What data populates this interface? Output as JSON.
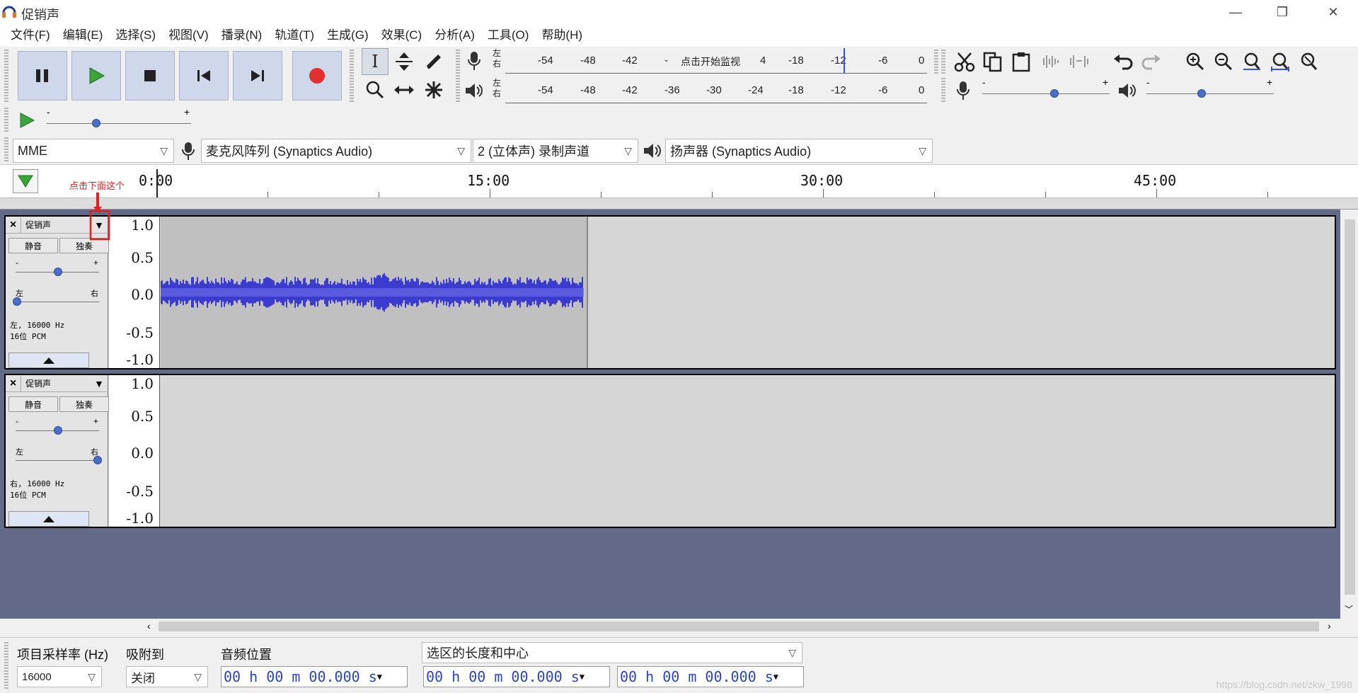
{
  "window": {
    "title": "促销声",
    "minimize_glyph": "—",
    "restore_glyph": "❐",
    "close_glyph": "✕"
  },
  "menu": [
    "文件(F)",
    "编辑(E)",
    "选择(S)",
    "视图(V)",
    "播录(N)",
    "轨道(T)",
    "生成(G)",
    "效果(C)",
    "分析(A)",
    "工具(O)",
    "帮助(H)"
  ],
  "meters": {
    "record_left": "左",
    "record_right": "右",
    "play_left": "左",
    "play_right": "右",
    "record_ticks": [
      "-54",
      "-48",
      "-42",
      "-",
      "点击开始监视",
      "4",
      "-18",
      "-12",
      "-6",
      "0"
    ],
    "play_ticks": [
      "-54",
      "-48",
      "-42",
      "-36",
      "-30",
      "-24",
      "-18",
      "-12",
      "-6",
      "0"
    ]
  },
  "mixer": {
    "minus": "-",
    "plus": "+"
  },
  "devices": {
    "host": "MME",
    "input": "麦克风阵列 (Synaptics Audio)",
    "channels": "2 (立体声) 录制声道",
    "output": "扬声器 (Synaptics Audio)"
  },
  "timeline": {
    "labels": [
      "0:00",
      "15:00",
      "30:00",
      "45:00"
    ]
  },
  "annotation": {
    "text": "点击下面这个"
  },
  "tracks": [
    {
      "name": "促销声",
      "mute": "静音",
      "solo": "独奏",
      "gain_minus": "-",
      "gain_plus": "+",
      "pan_left": "左",
      "pan_right": "右",
      "info_line1": "左, 16000 Hz",
      "info_line2": "16位 PCM",
      "ruler": [
        "1.0",
        "0.5",
        "0.0",
        "-0.5",
        "-1.0"
      ]
    },
    {
      "name": "促销声",
      "mute": "静音",
      "solo": "独奏",
      "gain_minus": "-",
      "gain_plus": "+",
      "pan_left": "左",
      "pan_right": "右",
      "info_line1": "右, 16000 Hz",
      "info_line2": "16位 PCM",
      "ruler": [
        "1.0",
        "0.5",
        "0.0",
        "-0.5",
        "-1.0"
      ]
    }
  ],
  "bottom": {
    "rate_label": "项目采样率 (Hz)",
    "rate_value": "16000",
    "snap_label": "吸附到",
    "snap_value": "关闭",
    "pos_label": "音频位置",
    "pos_value": "00 h 00 m 00.000 s",
    "sel_label": "选区的长度和中心",
    "sel_start": "00 h 00 m 00.000 s",
    "sel_end": "00 h 00 m 00.000 s"
  },
  "watermark": "https://blog.csdn.net/zkw_1998",
  "colors": {
    "transport_bg": "#cfd8ea",
    "record_red": "#e03030",
    "play_green": "#3aa63a",
    "waveform": "#3b3bd0",
    "track_bg": "#636a87",
    "annotation_red": "#e02020"
  }
}
